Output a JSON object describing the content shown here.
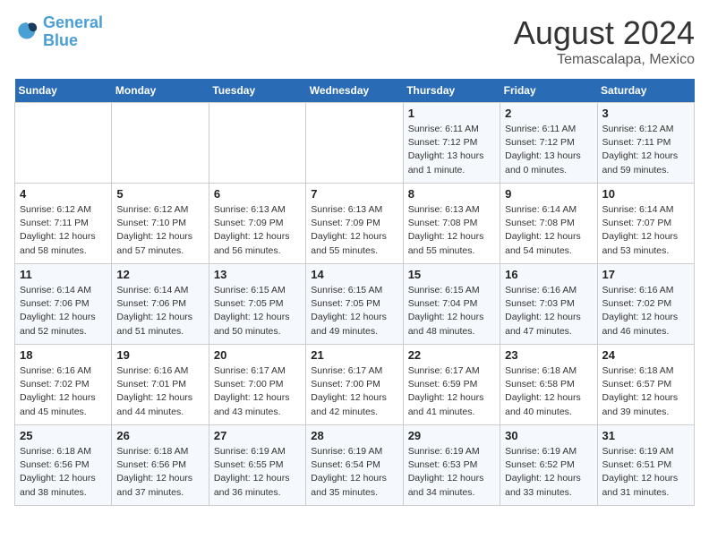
{
  "header": {
    "logo_line1": "General",
    "logo_line2": "Blue",
    "month": "August 2024",
    "location": "Temascalapa, Mexico"
  },
  "weekdays": [
    "Sunday",
    "Monday",
    "Tuesday",
    "Wednesday",
    "Thursday",
    "Friday",
    "Saturday"
  ],
  "weeks": [
    [
      {
        "day": "",
        "info": ""
      },
      {
        "day": "",
        "info": ""
      },
      {
        "day": "",
        "info": ""
      },
      {
        "day": "",
        "info": ""
      },
      {
        "day": "1",
        "info": "Sunrise: 6:11 AM\nSunset: 7:12 PM\nDaylight: 13 hours\nand 1 minute."
      },
      {
        "day": "2",
        "info": "Sunrise: 6:11 AM\nSunset: 7:12 PM\nDaylight: 13 hours\nand 0 minutes."
      },
      {
        "day": "3",
        "info": "Sunrise: 6:12 AM\nSunset: 7:11 PM\nDaylight: 12 hours\nand 59 minutes."
      }
    ],
    [
      {
        "day": "4",
        "info": "Sunrise: 6:12 AM\nSunset: 7:11 PM\nDaylight: 12 hours\nand 58 minutes."
      },
      {
        "day": "5",
        "info": "Sunrise: 6:12 AM\nSunset: 7:10 PM\nDaylight: 12 hours\nand 57 minutes."
      },
      {
        "day": "6",
        "info": "Sunrise: 6:13 AM\nSunset: 7:09 PM\nDaylight: 12 hours\nand 56 minutes."
      },
      {
        "day": "7",
        "info": "Sunrise: 6:13 AM\nSunset: 7:09 PM\nDaylight: 12 hours\nand 55 minutes."
      },
      {
        "day": "8",
        "info": "Sunrise: 6:13 AM\nSunset: 7:08 PM\nDaylight: 12 hours\nand 55 minutes."
      },
      {
        "day": "9",
        "info": "Sunrise: 6:14 AM\nSunset: 7:08 PM\nDaylight: 12 hours\nand 54 minutes."
      },
      {
        "day": "10",
        "info": "Sunrise: 6:14 AM\nSunset: 7:07 PM\nDaylight: 12 hours\nand 53 minutes."
      }
    ],
    [
      {
        "day": "11",
        "info": "Sunrise: 6:14 AM\nSunset: 7:06 PM\nDaylight: 12 hours\nand 52 minutes."
      },
      {
        "day": "12",
        "info": "Sunrise: 6:14 AM\nSunset: 7:06 PM\nDaylight: 12 hours\nand 51 minutes."
      },
      {
        "day": "13",
        "info": "Sunrise: 6:15 AM\nSunset: 7:05 PM\nDaylight: 12 hours\nand 50 minutes."
      },
      {
        "day": "14",
        "info": "Sunrise: 6:15 AM\nSunset: 7:05 PM\nDaylight: 12 hours\nand 49 minutes."
      },
      {
        "day": "15",
        "info": "Sunrise: 6:15 AM\nSunset: 7:04 PM\nDaylight: 12 hours\nand 48 minutes."
      },
      {
        "day": "16",
        "info": "Sunrise: 6:16 AM\nSunset: 7:03 PM\nDaylight: 12 hours\nand 47 minutes."
      },
      {
        "day": "17",
        "info": "Sunrise: 6:16 AM\nSunset: 7:02 PM\nDaylight: 12 hours\nand 46 minutes."
      }
    ],
    [
      {
        "day": "18",
        "info": "Sunrise: 6:16 AM\nSunset: 7:02 PM\nDaylight: 12 hours\nand 45 minutes."
      },
      {
        "day": "19",
        "info": "Sunrise: 6:16 AM\nSunset: 7:01 PM\nDaylight: 12 hours\nand 44 minutes."
      },
      {
        "day": "20",
        "info": "Sunrise: 6:17 AM\nSunset: 7:00 PM\nDaylight: 12 hours\nand 43 minutes."
      },
      {
        "day": "21",
        "info": "Sunrise: 6:17 AM\nSunset: 7:00 PM\nDaylight: 12 hours\nand 42 minutes."
      },
      {
        "day": "22",
        "info": "Sunrise: 6:17 AM\nSunset: 6:59 PM\nDaylight: 12 hours\nand 41 minutes."
      },
      {
        "day": "23",
        "info": "Sunrise: 6:18 AM\nSunset: 6:58 PM\nDaylight: 12 hours\nand 40 minutes."
      },
      {
        "day": "24",
        "info": "Sunrise: 6:18 AM\nSunset: 6:57 PM\nDaylight: 12 hours\nand 39 minutes."
      }
    ],
    [
      {
        "day": "25",
        "info": "Sunrise: 6:18 AM\nSunset: 6:56 PM\nDaylight: 12 hours\nand 38 minutes."
      },
      {
        "day": "26",
        "info": "Sunrise: 6:18 AM\nSunset: 6:56 PM\nDaylight: 12 hours\nand 37 minutes."
      },
      {
        "day": "27",
        "info": "Sunrise: 6:19 AM\nSunset: 6:55 PM\nDaylight: 12 hours\nand 36 minutes."
      },
      {
        "day": "28",
        "info": "Sunrise: 6:19 AM\nSunset: 6:54 PM\nDaylight: 12 hours\nand 35 minutes."
      },
      {
        "day": "29",
        "info": "Sunrise: 6:19 AM\nSunset: 6:53 PM\nDaylight: 12 hours\nand 34 minutes."
      },
      {
        "day": "30",
        "info": "Sunrise: 6:19 AM\nSunset: 6:52 PM\nDaylight: 12 hours\nand 33 minutes."
      },
      {
        "day": "31",
        "info": "Sunrise: 6:19 AM\nSunset: 6:51 PM\nDaylight: 12 hours\nand 31 minutes."
      }
    ]
  ]
}
